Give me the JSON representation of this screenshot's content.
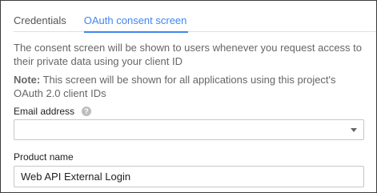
{
  "tabs": [
    {
      "label": "Credentials",
      "active": false
    },
    {
      "label": "OAuth consent screen",
      "active": true
    }
  ],
  "description": "The consent screen will be shown to users whenever you request access to their private data using your client ID",
  "note": {
    "prefix": "Note:",
    "text": " This screen will be shown for all applications using this project's OAuth 2.0 client IDs"
  },
  "email": {
    "label": "Email address",
    "help_icon": "?",
    "selected_value": ""
  },
  "product": {
    "label": "Product name",
    "value": "Web API External Login"
  },
  "colors": {
    "accent": "#4285f4",
    "muted_text": "#666666",
    "border": "#c7c7c7"
  }
}
